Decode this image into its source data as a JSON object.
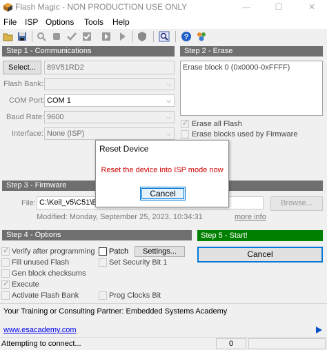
{
  "window": {
    "title": "Flash Magic - NON PRODUCTION USE ONLY"
  },
  "menu": {
    "file": "File",
    "isp": "ISP",
    "options": "Options",
    "tools": "Tools",
    "help": "Help"
  },
  "step1": {
    "header": "Step 1 - Communications",
    "select_button": "Select...",
    "device": "89V51RD2",
    "flash_bank_label": "Flash Bank:",
    "flash_bank_value": "",
    "com_port_label": "COM Port:",
    "com_port_value": "COM 1",
    "baud_rate_label": "Baud Rate:",
    "baud_rate_value": "9600",
    "interface_label": "Interface:",
    "interface_value": "None (ISP)"
  },
  "step2": {
    "header": "Step 2 - Erase",
    "erase_list": "Erase block 0 (0x0000-0xFFFF)",
    "erase_all": "Erase all Flash",
    "erase_all_checked": true,
    "erase_fw": "Erase blocks used by Firmware",
    "erase_fw_checked": false
  },
  "step3": {
    "header": "Step 3 - Firmware",
    "file_label": "File:",
    "file_value": "C:\\Keil_v5\\C51\\E",
    "browse_button": "Browse...",
    "modified": "Modified: Monday, September 25, 2023, 10:34:31",
    "more_info": "more info"
  },
  "step4": {
    "header": "Step 4 - Options",
    "verify": "Verify after programming",
    "verify_checked": true,
    "patch": "Patch",
    "settings_button": "Settings...",
    "fill_unused": "Fill unused Flash",
    "security_bit": "Set Security Bit 1",
    "gen_checksums": "Gen block checksums",
    "execute": "Execute",
    "execute_checked": true,
    "activate_bank": "Activate Flash Bank",
    "prog_clocks": "Prog Clocks Bit"
  },
  "step5": {
    "header": "Step 5 - Start!",
    "cancel_button": "Cancel"
  },
  "dialog": {
    "title": "Reset Device",
    "message": "Reset the device into ISP mode now",
    "cancel_button": "Cancel"
  },
  "footer": {
    "partner": "Your Training or Consulting Partner: Embedded Systems Academy",
    "link": "www.esacademy.com"
  },
  "status": {
    "text": "Attempting to connect...",
    "count": "0"
  },
  "colors": {
    "section_header": "#6f6f6f",
    "start_header": "#008000",
    "dialog_message": "#cc0000",
    "accent": "#0078d7"
  },
  "toolbar_icons": [
    "open-icon",
    "save-icon",
    "search-icon",
    "erase-icon",
    "verify-icon",
    "blank-check-icon",
    "run-icon",
    "next-icon",
    "security-icon",
    "sector-view-icon",
    "help-icon",
    "community-icon"
  ]
}
